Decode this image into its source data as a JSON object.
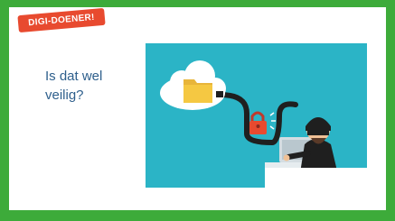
{
  "badge": {
    "label": "DIGI-DOENER!"
  },
  "slide": {
    "heading_line1": "Is dat wel",
    "heading_line2": "veilig?"
  },
  "colors": {
    "frame": "#3dab3a",
    "badge": "#e84a2f",
    "panel": "#2bb4c6",
    "heading": "#2e5f8c"
  },
  "illustration": {
    "icons": [
      "cloud-icon",
      "folder-icon",
      "padlock-icon",
      "hacker-icon",
      "laptop-icon"
    ]
  }
}
